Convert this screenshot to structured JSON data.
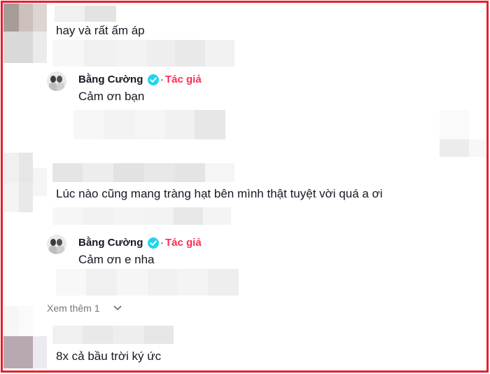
{
  "comments": [
    {
      "text": "hay và rất ấm áp"
    },
    {
      "text": "Lúc nào cũng mang tràng hạt bên mình thật tuyệt vời quá a ơi"
    },
    {
      "text": "8x cả bầu trời ký ức"
    }
  ],
  "replies": [
    {
      "name": "Bằng Cường",
      "separator": "·",
      "badge": "Tác giả",
      "text": "Cảm ơn bạn"
    },
    {
      "name": "Bằng Cường",
      "separator": "·",
      "badge": "Tác giả",
      "text": "Cảm ơn e nha"
    }
  ],
  "view_more": {
    "label": "Xem thêm 1"
  },
  "colors": {
    "author_badge": "#fe2c55",
    "verified": "#20d5ec",
    "frame": "#e5202b",
    "muted": "#757575"
  },
  "icons": {
    "verified": "verified-badge-icon",
    "chevron": "chevron-down-icon"
  }
}
